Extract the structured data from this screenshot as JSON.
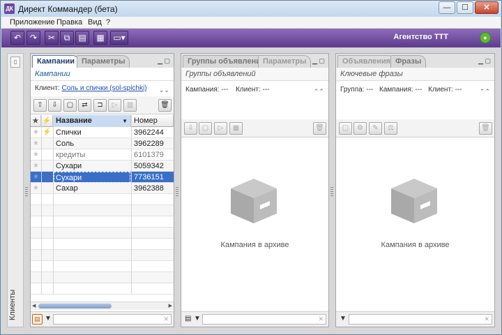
{
  "window": {
    "title": "Директ Коммандер (бета)",
    "minimize": "—",
    "maximize": "☐",
    "close": "✕"
  },
  "menu": [
    "Приложение",
    "Правка",
    "Вид",
    "?"
  ],
  "toolbar": {
    "buttons": [
      "undo-icon",
      "redo-icon",
      "cut-icon",
      "copy-icon",
      "paste-icon",
      "table-icon",
      "view-dropdown-icon"
    ],
    "agency": "Агентство ТТТ"
  },
  "left_strip": {
    "label": "Клиенты"
  },
  "campaigns_panel": {
    "tabs": [
      "Кампании",
      "Параметры"
    ],
    "subtitle": "Кампании",
    "client_label": "Клиент:",
    "client_link": "Соль и спички (sol-spichki)",
    "columns": [
      "Название",
      "Номер"
    ],
    "rows": [
      {
        "name": "Спички",
        "number": "3962244",
        "lightning": true,
        "dim": false,
        "selected": false
      },
      {
        "name": "Соль",
        "number": "3962289",
        "lightning": false,
        "dim": false,
        "selected": false
      },
      {
        "name": "кредиты",
        "number": "6101379",
        "lightning": false,
        "dim": true,
        "selected": false
      },
      {
        "name": "Сухари",
        "number": "5059342",
        "lightning": false,
        "dim": false,
        "selected": false
      },
      {
        "name": "Сухари",
        "number": "7736151",
        "lightning": false,
        "dim": false,
        "selected": true
      },
      {
        "name": "Сахар",
        "number": "3962388",
        "lightning": false,
        "dim": false,
        "selected": false
      }
    ]
  },
  "groups_panel": {
    "tabs": [
      "Группы объявлений",
      "Параметры"
    ],
    "subtitle": "Группы объявлений",
    "campaign_label": "Кампания: ---",
    "client_label": "Клиент: ---",
    "empty_text": "Кампания в архиве"
  },
  "ads_panel": {
    "tabs": [
      "Объявления",
      "Фразы"
    ],
    "subtitle": "Ключевые фразы",
    "group_label": "Группа: ---",
    "campaign_label": "Кампания: ---",
    "client_label": "Клиент: ---",
    "empty_text": "Кампания в архиве"
  },
  "colors": {
    "accent": "#5d3b8c",
    "selection": "#3a6fc8",
    "brand_title": "#1f3a72"
  }
}
